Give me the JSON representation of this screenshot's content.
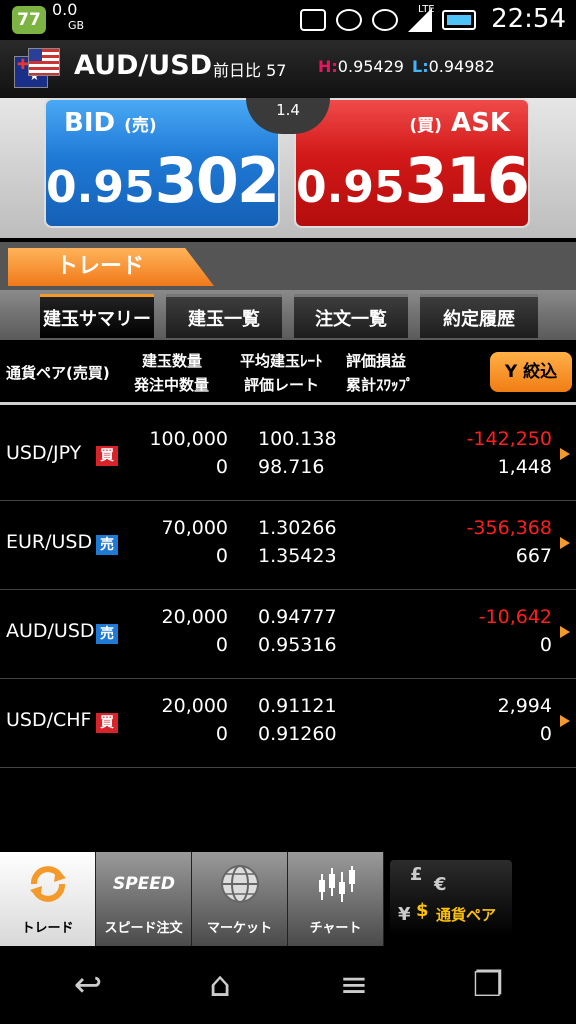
{
  "status_bar": {
    "battery_badge": "77",
    "data_amount": "0.0",
    "data_unit": "GB",
    "network": "LTE",
    "time": "22:54"
  },
  "header": {
    "pair": "AUD/USD",
    "change_label": "前日比",
    "change_value": "57",
    "high_key": "H:",
    "high_value": "0.95429",
    "low_key": "L:",
    "low_value": "0.94982"
  },
  "quote": {
    "bid_label": "BID",
    "bid_jp": "(売)",
    "bid_price_small": "0.95",
    "bid_price_large": "302",
    "ask_label": "ASK",
    "ask_jp": "(買)",
    "ask_price_small": "0.95",
    "ask_price_large": "316",
    "spread": "1.4"
  },
  "trade_tab": "トレード",
  "subtabs": [
    "建玉サマリー",
    "建玉一覧",
    "注文一覧",
    "約定履歴"
  ],
  "columns": {
    "pair": "通貨ペア(売買)",
    "qty1": "建玉数量",
    "qty2": "発注中数量",
    "rate1": "平均建玉ﾚｰﾄ",
    "rate2": "評価レート",
    "pl1": "評価損益",
    "pl2": "累計ｽﾜｯﾌﾟ",
    "filter": "絞込"
  },
  "rows": [
    {
      "pair": "USD/JPY",
      "side": "買",
      "qty": "100,000",
      "pending": "0",
      "avg_rate": "100.138",
      "eval_rate": "98.716",
      "pl": "-142,250",
      "swap": "1,448"
    },
    {
      "pair": "EUR/USD",
      "side": "売",
      "qty": "70,000",
      "pending": "0",
      "avg_rate": "1.30266",
      "eval_rate": "1.35423",
      "pl": "-356,368",
      "swap": "667"
    },
    {
      "pair": "AUD/USD",
      "side": "売",
      "qty": "20,000",
      "pending": "0",
      "avg_rate": "0.94777",
      "eval_rate": "0.95316",
      "pl": "-10,642",
      "swap": "0"
    },
    {
      "pair": "USD/CHF",
      "side": "買",
      "qty": "20,000",
      "pending": "0",
      "avg_rate": "0.91121",
      "eval_rate": "0.91260",
      "pl": "2,994",
      "swap": "0"
    }
  ],
  "bottom_nav": {
    "trade": "トレード",
    "speed_badge": "SPEED",
    "speed": "スピード注文",
    "market": "マーケット",
    "chart": "チャート",
    "currency": "通貨ペア"
  },
  "colors": {
    "bid": "#1f7ad6",
    "ask": "#d21818",
    "accent": "#f39a2a",
    "loss": "#ff1e1e"
  }
}
